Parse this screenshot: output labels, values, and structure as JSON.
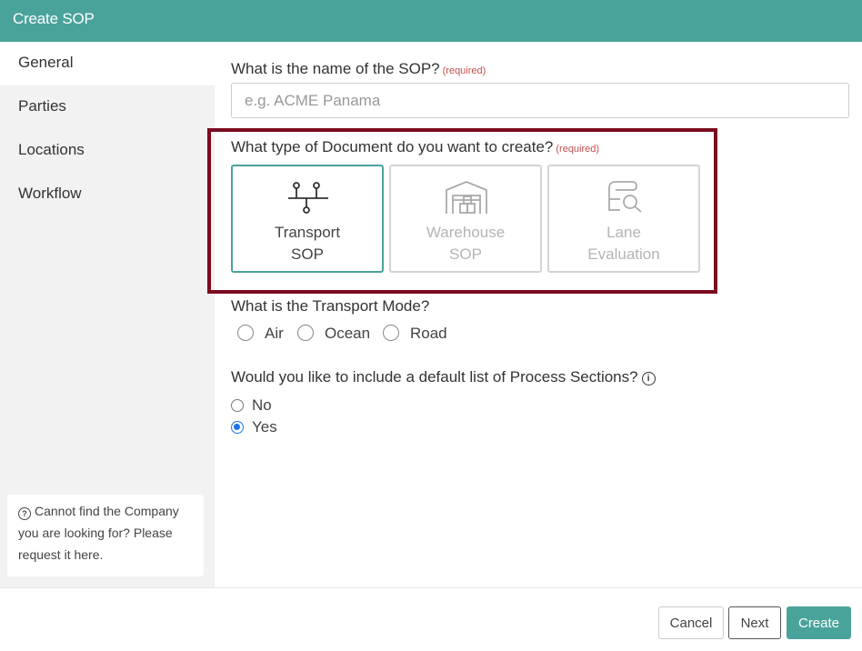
{
  "header": {
    "title": "Create SOP"
  },
  "sidebar": {
    "items": [
      {
        "label": "General",
        "active": true
      },
      {
        "label": "Parties",
        "active": false
      },
      {
        "label": "Locations",
        "active": false
      },
      {
        "label": "Workflow",
        "active": false
      }
    ],
    "help_text": "Cannot find the Company you are looking for? Please request it here."
  },
  "form": {
    "name_question": "What is the name of the SOP?",
    "required_tag": "(required)",
    "name_placeholder": "e.g. ACME Panama",
    "name_value": "",
    "doc_type_question": "What type of Document do you want to create?",
    "doc_types": [
      {
        "line1": "Transport",
        "line2": "SOP",
        "icon": "transport-icon",
        "selected": true
      },
      {
        "line1": "Warehouse",
        "line2": "SOP",
        "icon": "warehouse-icon",
        "selected": false
      },
      {
        "line1": "Lane",
        "line2": "Evaluation",
        "icon": "lane-evaluation-icon",
        "selected": false
      }
    ],
    "transport_mode_question": "What is the Transport Mode?",
    "transport_modes": [
      "Air",
      "Ocean",
      "Road"
    ],
    "process_sections_question": "Would you like to include a default list of Process Sections?",
    "process_options": [
      {
        "label": "No",
        "checked": false
      },
      {
        "label": "Yes",
        "checked": true
      }
    ]
  },
  "footer": {
    "cancel_label": "Cancel",
    "next_label": "Next",
    "create_label": "Create"
  },
  "colors": {
    "accent": "#4aa39a",
    "highlight_border": "#7a0b1f",
    "required": "#c0504d",
    "radio_checked": "#1a73e8"
  }
}
